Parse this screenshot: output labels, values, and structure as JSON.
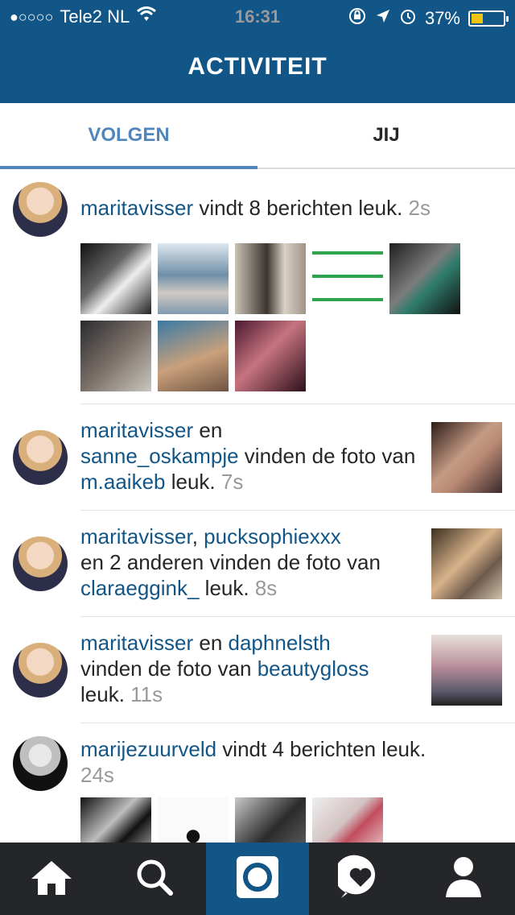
{
  "status_bar": {
    "carrier": "Tele2 NL",
    "time": "16:31",
    "battery": "37%",
    "battery_level": 0.37,
    "signal_dots": "●○○○○",
    "icons": [
      "wifi-icon",
      "orientation-lock-icon",
      "location-arrow-icon",
      "alarm-icon",
      "battery-icon"
    ]
  },
  "header": {
    "title": "ACTIVITEIT"
  },
  "tabs": [
    {
      "label": "VOLGEN",
      "active": true
    },
    {
      "label": "JIJ",
      "active": false
    }
  ],
  "feed": [
    {
      "actor": "maritavisser",
      "text": " vindt 8 berichten leuk.",
      "time": "2s",
      "thumbnails": 8
    },
    {
      "actor": "maritavisser",
      "connector": " en ",
      "actor2": "sanne_oskampje",
      "text": " vinden de foto van ",
      "target": "m.aaikeb",
      "suffix": " leuk.",
      "time": "7s"
    },
    {
      "actor": "maritavisser",
      "connector": ", ",
      "actor2": "pucksophiexxx",
      "text": " en 2 anderen vinden de foto van ",
      "target": "claraeggink_",
      "suffix": " leuk.",
      "time": "8s"
    },
    {
      "actor": "maritavisser",
      "connector": " en ",
      "actor2": "daphnelsth",
      "text": " vinden de foto van ",
      "target": "beautygloss",
      "suffix": " leuk.",
      "time": "11s"
    },
    {
      "actor": "marijezuurveld",
      "text": " vindt 4 berichten leuk.",
      "time": "24s",
      "thumbnails": 4
    }
  ],
  "bottom_nav": [
    {
      "icon": "home-icon",
      "active": false
    },
    {
      "icon": "search-icon",
      "active": false
    },
    {
      "icon": "camera-icon",
      "active": true
    },
    {
      "icon": "activity-heart-icon",
      "active": false
    },
    {
      "icon": "profile-icon",
      "active": false
    }
  ],
  "colors": {
    "header": "#125688",
    "tab_active": "#4f86bd",
    "username": "#125688",
    "timestamp": "#999999",
    "bottom_bar": "#24262a"
  }
}
